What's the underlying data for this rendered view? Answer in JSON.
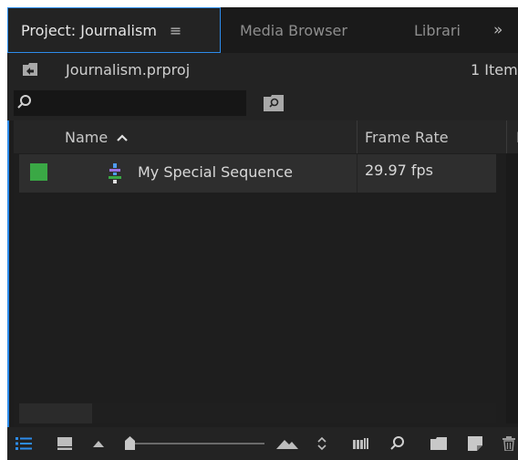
{
  "tabs": [
    {
      "label": "Project: Journalism",
      "active": true
    },
    {
      "label": "Media Browser",
      "active": false
    },
    {
      "label": "Librari",
      "active": false
    },
    {
      "label": "»",
      "active": false
    }
  ],
  "project": {
    "file_name": "Journalism.prproj",
    "item_count": "1 Item"
  },
  "search": {
    "value": "",
    "placeholder": ""
  },
  "table": {
    "columns": [
      "Name",
      "Frame Rate",
      "M"
    ],
    "sort_column": "Name",
    "sort_direction": "ascending",
    "rows": [
      {
        "label_color": "#3aa845",
        "icon": "sequence-icon",
        "name": "My Special Sequence",
        "frame_rate": "29.97 fps"
      }
    ]
  },
  "toolbar": {
    "items": [
      "list-view-icon",
      "icon-view-icon",
      "freeform-view-icon",
      "zoom-slider",
      "automate-to-sequence-icon",
      "sort-icons-icon",
      "find-icon",
      "new-bin-icon",
      "new-item-icon",
      "clear-icon"
    ],
    "zoom_level": 0.03
  },
  "colors": {
    "accent": "#2d8ceb",
    "panel": "#232323",
    "label_green": "#3aa845"
  }
}
